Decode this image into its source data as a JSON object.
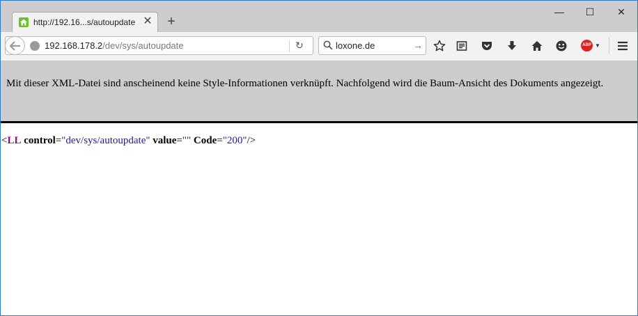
{
  "window": {
    "minimize": "—",
    "maximize": "☐",
    "close": "✕"
  },
  "tab": {
    "title": "http://192.16...s/autoupdate",
    "close": "✕"
  },
  "newtab": "+",
  "navbar": {
    "url_host": "192.168.178.2",
    "url_path": "/dev/sys/autoupdate",
    "reload": "↻",
    "search_value": "loxone.de",
    "search_go": "→",
    "abp_label": "ABP",
    "abp_arrow": "▼"
  },
  "content": {
    "info_text": "Mit dieser XML-Datei sind anscheinend keine Style-Informationen verknüpft. Nachfolgend wird die Baum-Ansicht des Dokuments angezeigt.",
    "xml": {
      "open": "<",
      "tag": "LL",
      "attr1_name": "control",
      "attr1_value": "\"dev/sys/autoupdate\"",
      "attr2_name": "value",
      "attr2_value": "\"\"",
      "attr3_name": "Code",
      "attr3_value": "\"200\"",
      "eq": "=",
      "close": "/>"
    }
  }
}
